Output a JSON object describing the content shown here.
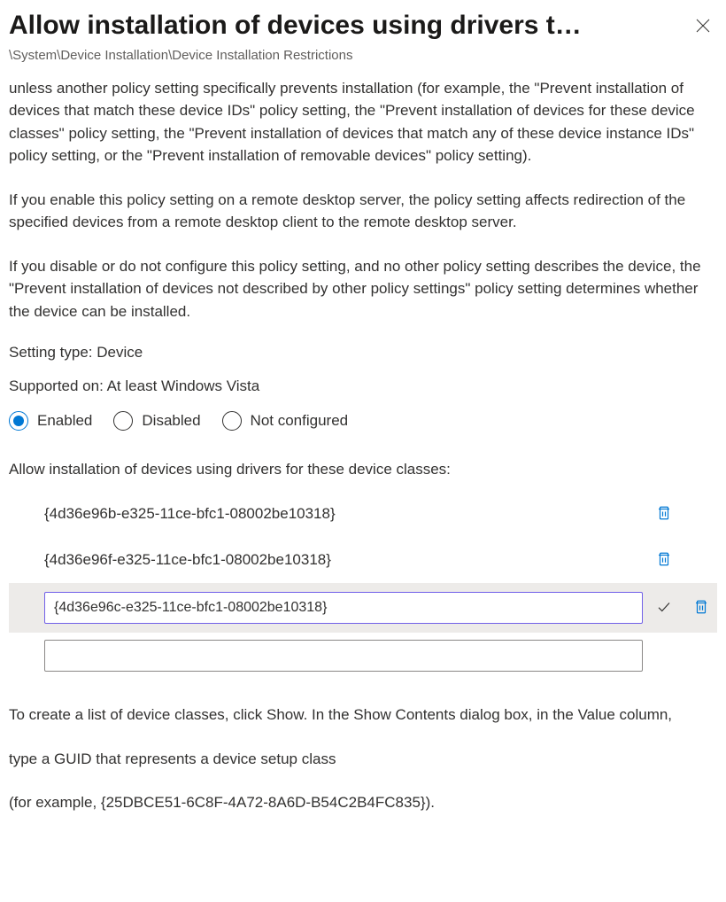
{
  "header": {
    "title": "Allow installation of devices using drivers t…",
    "breadcrumb": "\\System\\Device Installation\\Device Installation Restrictions"
  },
  "description": {
    "para1": "unless another policy setting specifically prevents installation (for example, the \"Prevent installation of devices that match these device IDs\" policy setting, the \"Prevent installation of devices for these device classes\" policy setting, the \"Prevent installation of devices that match any of these device instance IDs\" policy setting, or the \"Prevent installation of removable devices\" policy setting).",
    "para2": "If you enable this policy setting on a remote desktop server, the policy setting affects redirection of the specified devices from a remote desktop client to the remote desktop server.",
    "para3": "If you disable or do not configure this policy setting, and no other policy setting describes the device, the \"Prevent installation of devices not described by other policy settings\" policy setting determines whether the device can be installed."
  },
  "meta": {
    "setting_type": "Setting type: Device",
    "supported_on": "Supported on: At least Windows Vista"
  },
  "state": {
    "options": {
      "enabled": "Enabled",
      "disabled": "Disabled",
      "not_configured": "Not configured"
    },
    "selected": "enabled"
  },
  "list": {
    "label": "Allow installation of devices using drivers for these device classes:",
    "items": [
      "{4d36e96b-e325-11ce-bfc1-08002be10318}",
      "{4d36e96f-e325-11ce-bfc1-08002be10318}"
    ],
    "editing_value": "{4d36e96c-e325-11ce-bfc1-08002be10318}",
    "new_value": ""
  },
  "help": {
    "p1": "To create a list of device classes, click Show. In the Show Contents dialog box, in the Value column,",
    "p2": "type a GUID that represents a device setup class",
    "p3": "(for example, {25DBCE51-6C8F-4A72-8A6D-B54C2B4FC835})."
  }
}
